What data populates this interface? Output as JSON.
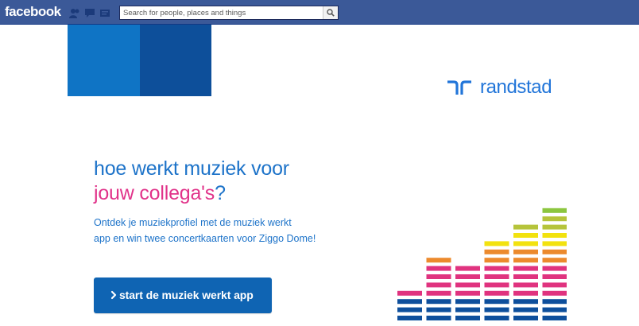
{
  "facebook": {
    "logo_text": "facebook",
    "search_placeholder": "Search for people, places and things",
    "icons": [
      "friend-requests-icon",
      "messages-icon",
      "notifications-icon"
    ],
    "search_icon": "search-icon"
  },
  "brand": {
    "logo_text": "randstad",
    "logo_mark": "randstad-logo-mark",
    "colors": {
      "primary_blue": "#1d73c9",
      "dark_blue": "#0d4f9a",
      "pink": "#e1338a",
      "button_blue": "#0f64b3"
    }
  },
  "promo": {
    "headline_line1": "hoe werkt muziek voor",
    "headline_line2_pink": "jouw collega's",
    "headline_line2_suffix": "?",
    "description_line1": "Ontdek je muziekprofiel met de muziek werkt",
    "description_line2": "app en win twee concertkaarten voor Ziggo Dome!",
    "cta_label": "start de muziek werkt app",
    "cta_icon": "chevron-right-icon"
  },
  "equalizer": {
    "column_levels": [
      4,
      8,
      7,
      10,
      12,
      14
    ],
    "colors": {
      "blue": "#0e4f9c",
      "pink": "#e0337f",
      "orange": "#ec8a2d",
      "yellow": "#f2e20f",
      "olive": "#b6c43b",
      "green": "#8cc63f"
    }
  }
}
